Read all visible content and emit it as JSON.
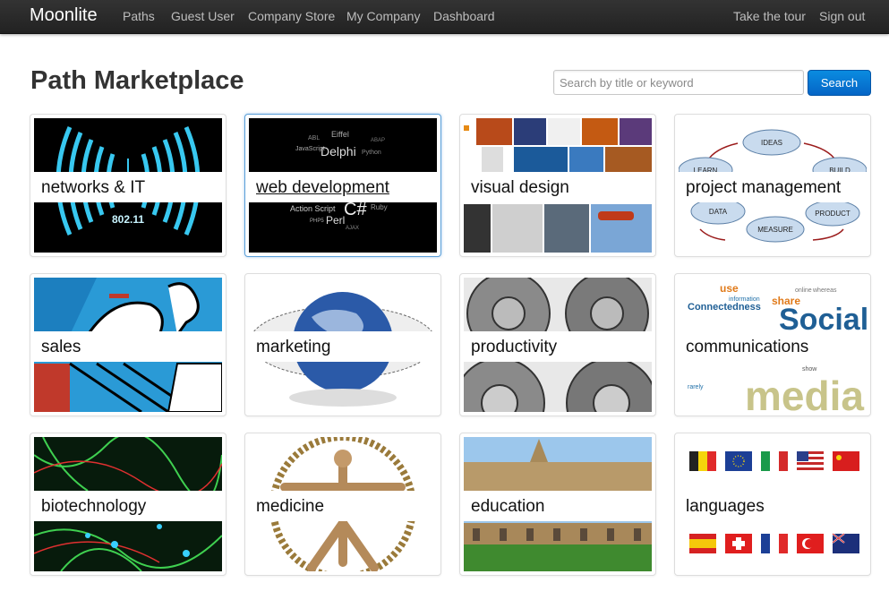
{
  "navbar": {
    "brand": "Moonlite",
    "items": [
      "Paths",
      "Guest User",
      "Company Store",
      "My Company",
      "Dashboard"
    ],
    "right_items": [
      "Take the tour",
      "Sign out"
    ]
  },
  "page": {
    "title": "Path Marketplace"
  },
  "search": {
    "placeholder": "Search by title or keyword",
    "button_label": "Search"
  },
  "cards": [
    {
      "label": "networks & IT",
      "image_text": "802.11"
    },
    {
      "label": "web development",
      "image_words": [
        "ABL",
        "Eiffel",
        "ABAP",
        "JavaScript",
        "Delphi",
        "Python",
        "Action Script",
        "C#",
        "Ruby",
        "PHP5",
        "Perl",
        "AJAX"
      ]
    },
    {
      "label": "visual design"
    },
    {
      "label": "project management",
      "image_words": [
        "IDEAS",
        "LEARN",
        "BUILD",
        "DATA",
        "PRODUCT",
        "MEASURE"
      ]
    },
    {
      "label": "sales"
    },
    {
      "label": "marketing"
    },
    {
      "label": "productivity"
    },
    {
      "label": "communications",
      "image_words": [
        "Social",
        "media",
        "share",
        "Connectedness",
        "use",
        "information",
        "rarely",
        "show",
        "online",
        "whereas"
      ]
    },
    {
      "label": "biotechnology"
    },
    {
      "label": "medicine"
    },
    {
      "label": "education"
    },
    {
      "label": "languages"
    }
  ]
}
